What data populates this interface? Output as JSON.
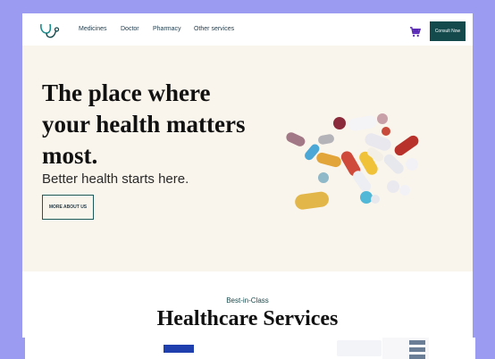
{
  "nav": {
    "items": [
      "Medicines",
      "Doctor",
      "Pharmacy",
      "Other services"
    ],
    "consult_label": "Consult Now"
  },
  "hero": {
    "title": "The place where your health matters most.",
    "subtitle": "Better health starts here.",
    "cta_label": "MORE ABOUT US"
  },
  "services": {
    "eyebrow": "Best-in-Class",
    "title": "Healthcare Services"
  },
  "colors": {
    "accent": "#154a4d",
    "hero_bg": "#FAF5EC",
    "page_bg": "#9B9BF2",
    "cart": "#5b2bb8"
  },
  "icons": {
    "logo": "stethoscope-icon",
    "cart": "shopping-cart-icon"
  }
}
